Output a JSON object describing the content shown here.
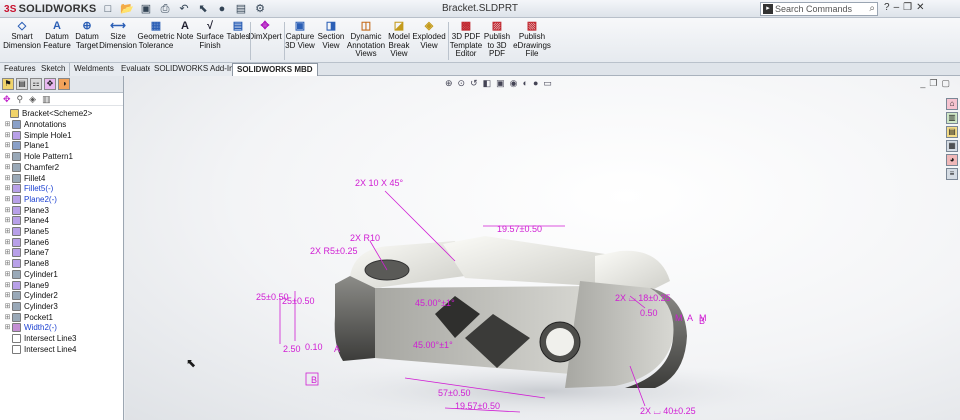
{
  "app": {
    "logo_text": "SOLIDWORKS",
    "document_title": "Bracket.SLDPRT"
  },
  "search": {
    "placeholder": "Search Commands"
  },
  "ribbon": {
    "buttons": [
      {
        "label": "Smart Dimension",
        "icon": "smart-dimension-icon"
      },
      {
        "label": "Datum Feature",
        "icon": "datum-feature-icon"
      },
      {
        "label": "Datum Target",
        "icon": "datum-target-icon"
      },
      {
        "label": "Size Dimension",
        "icon": "size-dimension-icon"
      },
      {
        "label": "Geometric Tolerance",
        "icon": "geometric-tolerance-icon"
      },
      {
        "label": "Note",
        "icon": "note-icon"
      },
      {
        "label": "Surface Finish",
        "icon": "surface-finish-icon"
      },
      {
        "label": "Tables",
        "icon": "tables-icon"
      },
      {
        "label": "DimXpert",
        "icon": "dimxpert-icon"
      },
      {
        "label": "Capture 3D View",
        "icon": "capture-3d-view-icon"
      },
      {
        "label": "Section View",
        "icon": "section-view-icon"
      },
      {
        "label": "Dynamic Annotation Views",
        "icon": "dynamic-annotation-icon"
      },
      {
        "label": "Model Break View",
        "icon": "model-break-icon"
      },
      {
        "label": "Exploded View",
        "icon": "exploded-view-icon"
      },
      {
        "label": "3D PDF Template Editor",
        "icon": "pdf-template-icon"
      },
      {
        "label": "Publish to 3D PDF",
        "icon": "publish-3d-pdf-icon"
      },
      {
        "label": "Publish eDrawings File",
        "icon": "publish-edrawings-icon"
      }
    ]
  },
  "tabs": [
    "Features",
    "Sketch",
    "Weldments",
    "Evaluate",
    "SOLIDWORKS Add-Ins",
    "SOLIDWORKS MBD"
  ],
  "tree": {
    "root": "Bracket<Scheme2>",
    "items": [
      {
        "label": "Annotations",
        "blue": false
      },
      {
        "label": "Simple Hole1",
        "blue": false
      },
      {
        "label": "Plane1",
        "blue": false
      },
      {
        "label": "Hole Pattern1",
        "blue": false
      },
      {
        "label": "Chamfer2",
        "blue": false
      },
      {
        "label": "Fillet4",
        "blue": false
      },
      {
        "label": "Fillet5(-)",
        "blue": true
      },
      {
        "label": "Plane2(-)",
        "blue": true
      },
      {
        "label": "Plane3",
        "blue": false
      },
      {
        "label": "Plane4",
        "blue": false
      },
      {
        "label": "Plane5",
        "blue": false
      },
      {
        "label": "Plane6",
        "blue": false
      },
      {
        "label": "Plane7",
        "blue": false
      },
      {
        "label": "Plane8",
        "blue": false
      },
      {
        "label": "Cylinder1",
        "blue": false
      },
      {
        "label": "Plane9",
        "blue": false
      },
      {
        "label": "Cylinder2",
        "blue": false
      },
      {
        "label": "Cylinder3",
        "blue": false
      },
      {
        "label": "Pocket1",
        "blue": false
      },
      {
        "label": "Width2(-)",
        "blue": true
      },
      {
        "label": "Intersect Line3",
        "blue": false
      },
      {
        "label": "Intersect Line4",
        "blue": false
      }
    ]
  },
  "model": {
    "annotations": [
      "2X 10 X 45°",
      "2X R10",
      "2X R5±0.25",
      "19.57±0.50",
      "25±0.50",
      "25±0.50",
      "45.00°±1°",
      "45.00°±1°",
      "2.50",
      "0.10",
      "A",
      "B",
      "57±0.50",
      "19.57±0.50",
      "2X ⌴ 18±0.25",
      "0.50",
      "M",
      "A",
      "M",
      "B",
      "2X ⌴ 40±0.25"
    ],
    "colors": {
      "annotation": "#d01dd4",
      "body": "#c9c9c4"
    }
  }
}
